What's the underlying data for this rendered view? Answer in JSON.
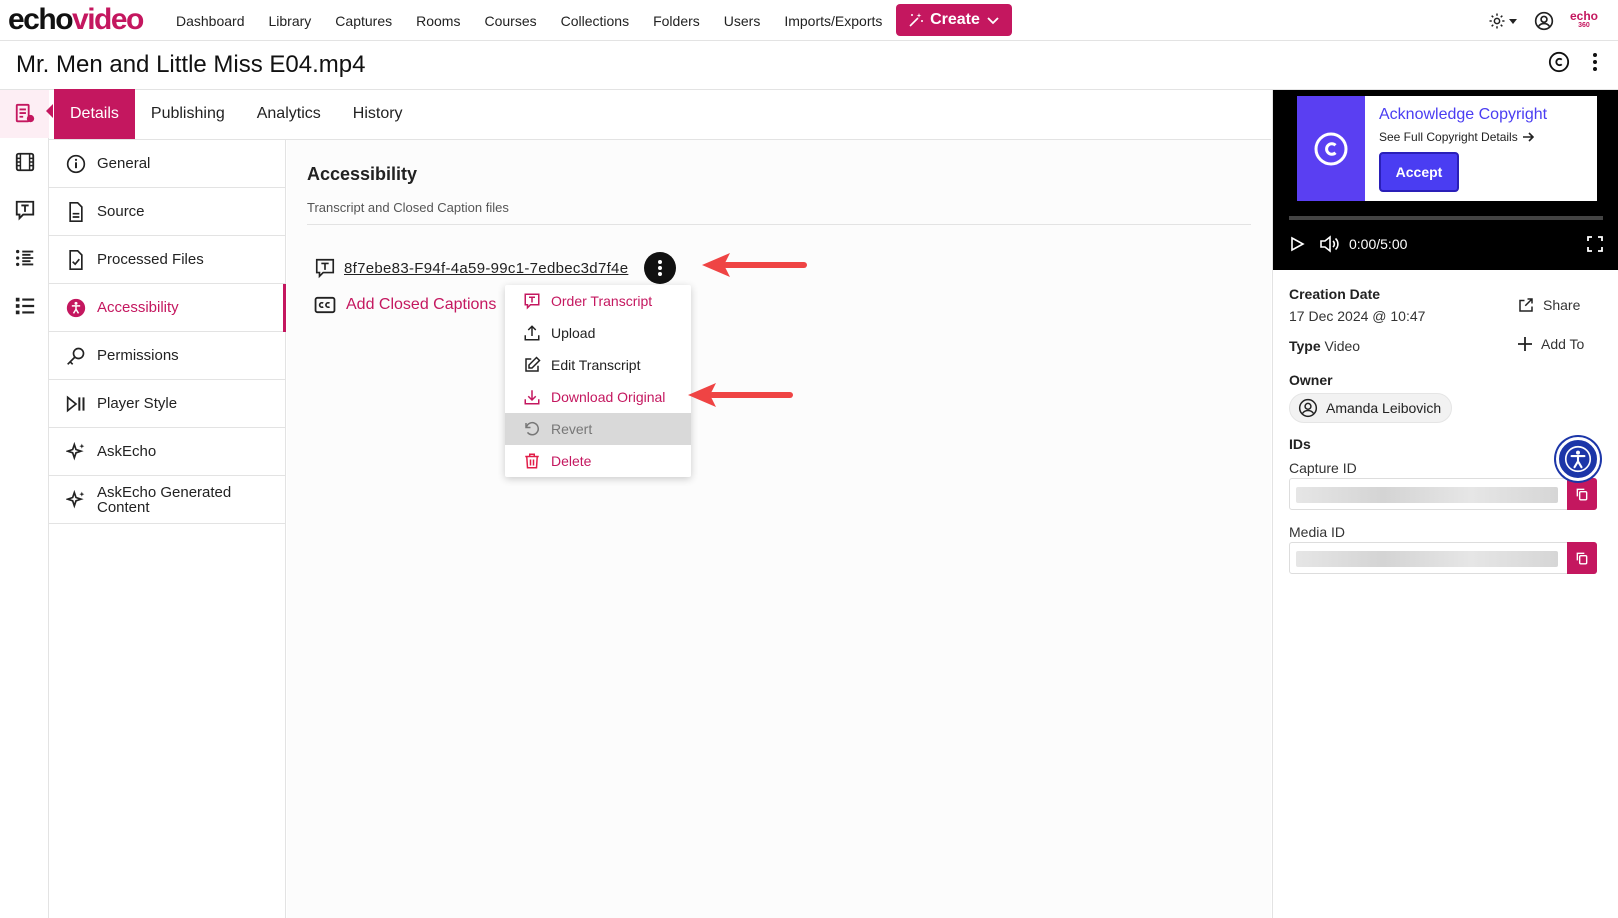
{
  "logo": {
    "echo": "echo",
    "video": "video"
  },
  "nav": {
    "links": [
      "Dashboard",
      "Library",
      "Captures",
      "Rooms",
      "Courses",
      "Collections",
      "Folders",
      "Users",
      "Imports/Exports"
    ],
    "create_label": "Create"
  },
  "brand_small": {
    "top": "echo",
    "bottom": "360"
  },
  "page": {
    "title": "Mr. Men and Little Miss E04.mp4"
  },
  "tabs": [
    "Details",
    "Publishing",
    "Analytics",
    "History"
  ],
  "submenu": [
    {
      "label": "General",
      "icon": "info-icon"
    },
    {
      "label": "Source",
      "icon": "file-icon"
    },
    {
      "label": "Processed Files",
      "icon": "file-check-icon"
    },
    {
      "label": "Accessibility",
      "icon": "accessibility-icon"
    },
    {
      "label": "Permissions",
      "icon": "key-icon"
    },
    {
      "label": "Player Style",
      "icon": "play-pause-icon"
    },
    {
      "label": "AskEcho",
      "icon": "sparkle-icon"
    },
    {
      "label": "AskEcho Generated Content",
      "icon": "sparkle-icon"
    }
  ],
  "section": {
    "title": "Accessibility",
    "subtitle": "Transcript and Closed Caption files",
    "file_name": "8f7ebe83-F94f-4a59-99c1-7edbec3d7f4e",
    "add_cc_label": "Add Closed Captions"
  },
  "dropdown": [
    {
      "label": "Order Transcript",
      "icon": "transcript-icon",
      "state": "pink"
    },
    {
      "label": "Upload",
      "icon": "upload-icon",
      "state": "normal"
    },
    {
      "label": "Edit Transcript",
      "icon": "edit-icon",
      "state": "normal"
    },
    {
      "label": "Download Original",
      "icon": "download-icon",
      "state": "pink"
    },
    {
      "label": "Revert",
      "icon": "revert-icon",
      "state": "disabled"
    },
    {
      "label": "Delete",
      "icon": "trash-icon",
      "state": "red"
    }
  ],
  "player": {
    "copyright_title": "Acknowledge Copyright",
    "copyright_link": "See Full Copyright Details",
    "accept_label": "Accept",
    "time": "0:00/5:00"
  },
  "meta": {
    "creation_label": "Creation Date",
    "creation_value": "17 Dec 2024 @ 10:47",
    "type_label": "Type",
    "type_value": "Video",
    "owner_label": "Owner",
    "owner_name": "Amanda Leibovich",
    "ids_label": "IDs",
    "capture_id_label": "Capture ID",
    "media_id_label": "Media ID",
    "share_label": "Share",
    "add_to_label": "Add To"
  },
  "colors": {
    "brand": "#c4175f",
    "accent": "#4a3df2",
    "arrow": "#ef4444"
  }
}
